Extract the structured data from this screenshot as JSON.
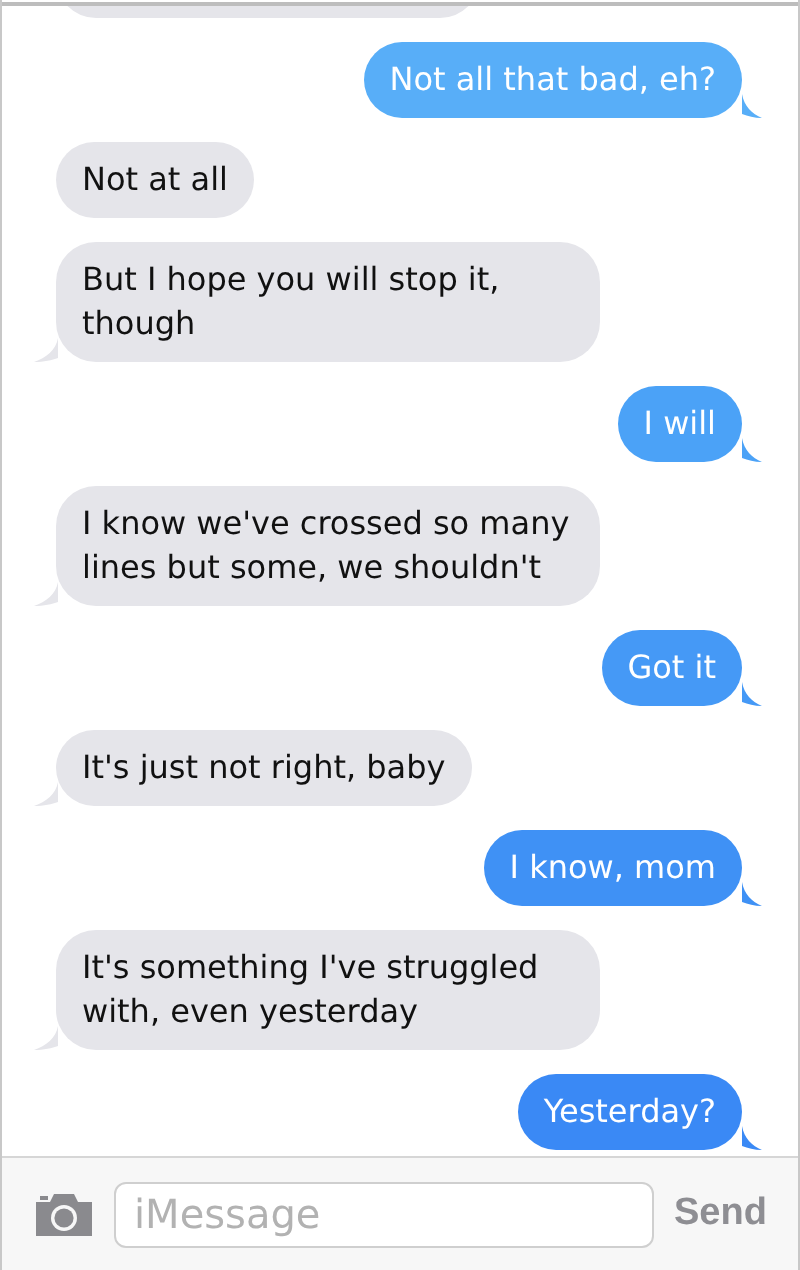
{
  "messages": [
    {
      "kind": "sent",
      "text": "Not all that bad, eh?",
      "color": "#58aef8"
    },
    {
      "kind": "received",
      "text": "Not at all",
      "tail": false
    },
    {
      "kind": "received",
      "text": "But I hope you will stop it, though",
      "tail": true
    },
    {
      "kind": "sent",
      "text": "I will",
      "color": "#4ba2f7"
    },
    {
      "kind": "received",
      "text": "I know we've crossed so many lines but some, we shouldn't",
      "tail": true
    },
    {
      "kind": "sent",
      "text": "Got it",
      "color": "#4599f6"
    },
    {
      "kind": "received",
      "text": "It's just not right, baby",
      "tail": true
    },
    {
      "kind": "sent",
      "text": "I know, mom",
      "color": "#3f91f5"
    },
    {
      "kind": "received",
      "text": "It's something I've struggled with, even yesterday",
      "tail": true
    },
    {
      "kind": "sent",
      "text": "Yesterday?",
      "color": "#3a89f5"
    }
  ],
  "composer": {
    "placeholder": "iMessage",
    "send": "Send"
  }
}
